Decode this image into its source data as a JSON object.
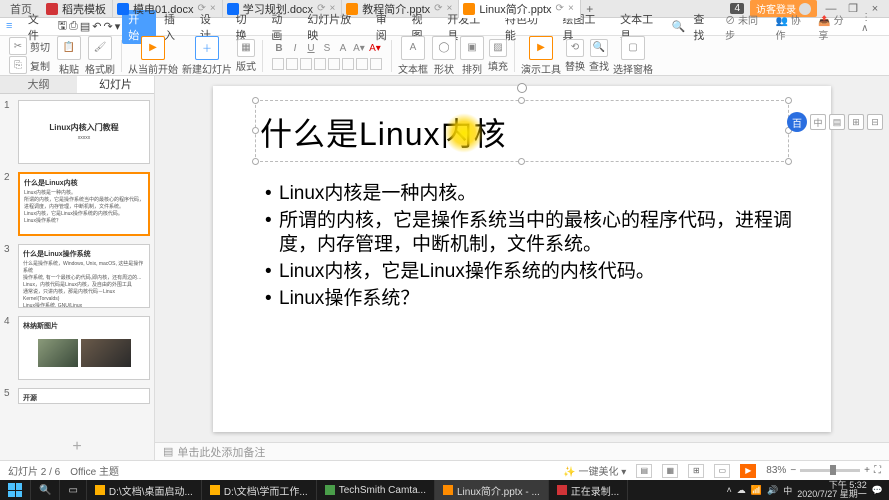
{
  "tabs": {
    "home": "首页",
    "docs": [
      {
        "label": "稻壳模板",
        "icon": "kico"
      },
      {
        "label": "模电01.docx",
        "icon": "wico"
      },
      {
        "label": "学习规划.docx",
        "icon": "wico"
      },
      {
        "label": "教程简介.pptx",
        "icon": "pico"
      },
      {
        "label": "Linux简介.pptx",
        "icon": "pico",
        "active": true
      }
    ],
    "badge": "4",
    "login": "访客登录"
  },
  "menu": {
    "file": "文件",
    "items": [
      "开始",
      "插入",
      "设计",
      "切换",
      "动画",
      "幻灯片放映",
      "审阅",
      "视图",
      "开发工具",
      "特色功能",
      "绘图工具",
      "文本工具"
    ],
    "active": 0,
    "search": "查找",
    "right": [
      "未同步",
      "协作",
      "分享"
    ]
  },
  "ribbon": {
    "cut": "剪切",
    "copy": "复制",
    "fmtpaint": "格式刷",
    "paste": "粘贴",
    "fromstart": "从当前开始",
    "newslide": "新建幻灯片",
    "layout": "版式",
    "textbox": "文本框",
    "shape": "形状",
    "arrange": "排列",
    "fill": "填充",
    "showtool": "演示工具",
    "replace": "替换",
    "find": "查找",
    "select": "选择窗格"
  },
  "leftpane": {
    "outline": "大纲",
    "slides": "幻灯片",
    "s1_title": "Linux内核入门教程",
    "s1_sub": "xxxxx",
    "s2_title": "什么是Linux内核",
    "s2_lines": [
      "Linux内核是一种内核。",
      "所谓的内核，它是操作系统当中的最核心的程序代码，进程调度，内存管理，中断机制，文件系统。",
      "Linux内核，它是Linux操作系统的内核代码。",
      "Linux操作系统？"
    ],
    "s3_title": "什么是Linux操作系统",
    "s3_lines": [
      "什么是操作系统，Windows, Unix, macOS, 这些是操作系统",
      "操作系统, 有一个最核心的代码,即内核，还有周边的...",
      "Linux，内核代码是Linux内核，及自由的外围工具",
      "通常说，只讲内核，那是内核代码－Linux Kernel(Torvalds)",
      "Linux操作系统, GNU/Linux"
    ],
    "s4_title": "林纳斯图片",
    "s5_title": "开源"
  },
  "slide": {
    "title": "什么是Linux内核",
    "b1": "Linux内核是一种内核。",
    "b2": "所谓的内核，它是操作系统当中的最核心的程序代码，进程调度，内存管理，中断机制，文件系统。",
    "b3": "Linux内核，它是Linux操作系统的内核代码。",
    "b4": "Linux操作系统？"
  },
  "notes": "单击此处添加备注",
  "status": {
    "pos": "幻灯片 2 / 6",
    "theme": "Office 主题",
    "beautify": "一键美化",
    "zoom": "83%"
  },
  "taskbar": {
    "items": [
      "D:\\文档\\桌面启动...",
      "D:\\文档\\学而工作...",
      "TechSmith Camta...",
      "Linux简介.pptx - ...",
      "正在录制..."
    ],
    "time": "下午 5:32",
    "date": "2020/7/27 星期一"
  }
}
